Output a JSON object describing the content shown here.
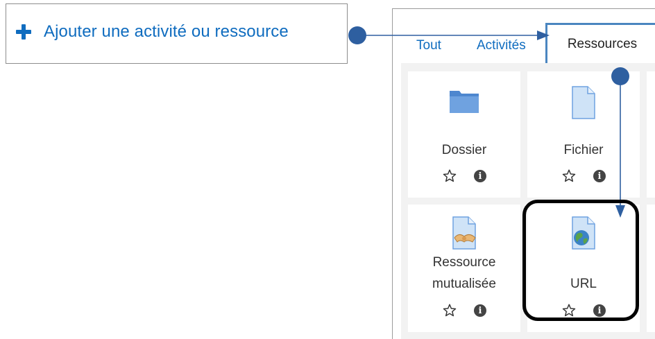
{
  "add_button": {
    "label": "Ajouter une activité ou ressource",
    "icon": "plus-icon"
  },
  "chooser": {
    "tabs": [
      {
        "label": "Tout",
        "selected": false
      },
      {
        "label": "Activités",
        "selected": false
      },
      {
        "label": "Ressources",
        "selected": true
      }
    ],
    "items": [
      {
        "name": "Dossier",
        "icon": "folder-icon"
      },
      {
        "name": "Fichier",
        "icon": "file-icon"
      },
      {
        "name": "Ressource mutualisée",
        "name_line1": "Ressource",
        "name_line2": "mutualisée",
        "icon": "shared-resource-icon"
      },
      {
        "name": "URL",
        "icon": "url-globe-icon"
      }
    ]
  },
  "colors": {
    "link_blue": "#0f6cbf",
    "annotation_blue": "#2e5fa0",
    "tab_highlight": "#4a86c0",
    "highlight_box": "#000000"
  }
}
